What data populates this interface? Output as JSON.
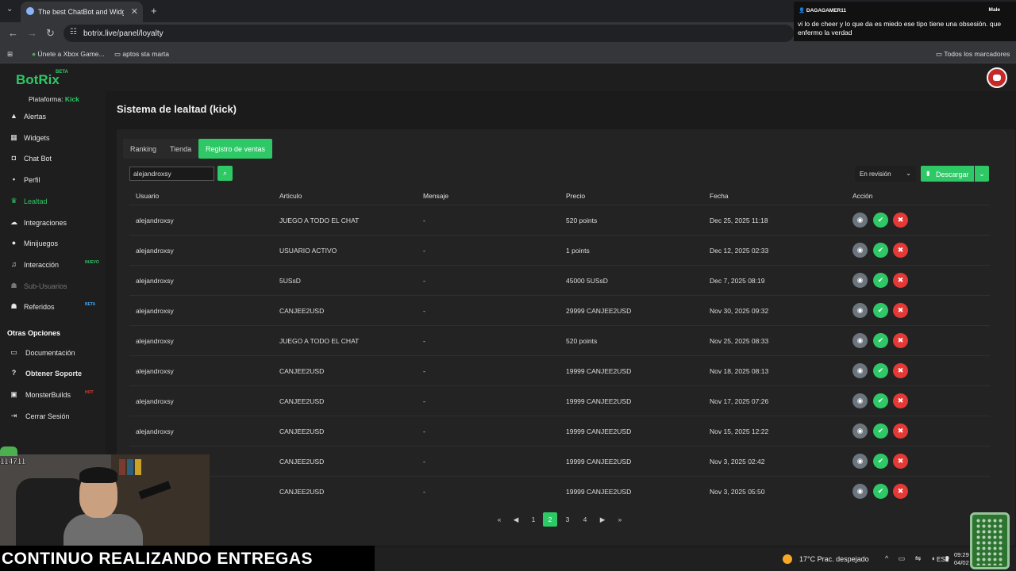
{
  "browser": {
    "tab_title": "The best ChatBot and Widgets",
    "url": "botrix.live/panel/loyalty",
    "bookmarks": [
      "Únete a Xbox Game...",
      "aptos sta marta"
    ],
    "all_bookmarks": "Todos los marcadores"
  },
  "chat_overlay": {
    "user": "DAGAGAMER11",
    "tag": "Male",
    "message": "vi lo de cheer y lo que da es miedo ese tipo tiene una obsesión. que enfermo la verdad"
  },
  "app": {
    "logo": "BotRix",
    "beta": "BETA",
    "platform_label": "Plataforma:",
    "platform_value": "Kick"
  },
  "sidebar": {
    "items": [
      {
        "label": "Alertas",
        "icon": "warning-icon"
      },
      {
        "label": "Widgets",
        "icon": "grid-icon"
      },
      {
        "label": "Chat Bot",
        "icon": "robot-icon"
      },
      {
        "label": "Perfil",
        "icon": "user-icon"
      },
      {
        "label": "Lealtad",
        "icon": "trophy-icon"
      },
      {
        "label": "Integraciones",
        "icon": "cloud-icon"
      },
      {
        "label": "Minijuegos",
        "icon": "gamepad-icon"
      },
      {
        "label": "Interacción",
        "icon": "music-icon",
        "badge": "NUEVO"
      },
      {
        "label": "Sub-Usuarios",
        "icon": "users-icon"
      },
      {
        "label": "Referidos",
        "icon": "users-icon",
        "badge": "BETA"
      }
    ],
    "other_title": "Otras Opciones",
    "other_items": [
      {
        "label": "Documentación",
        "icon": "book-icon"
      },
      {
        "label": "Obtener Soporte",
        "icon": "help-icon"
      },
      {
        "label": "MonsterBuilds",
        "icon": "monitor-icon",
        "badge": "HOT"
      },
      {
        "label": "Cerrar Sesión",
        "icon": "logout-icon"
      }
    ]
  },
  "main": {
    "title": "Sistema de lealtad (kick)",
    "tabs": [
      "Ranking",
      "Tienda",
      "Registro de ventas"
    ],
    "search_value": "alejandroxsy",
    "filter_value": "En revisión",
    "download_label": "Descargar",
    "columns": [
      "Usuario",
      "Articulo",
      "Mensaje",
      "Precio",
      "Fecha",
      "Acción"
    ],
    "rows": [
      {
        "user": "alejandroxsy",
        "item": "JUEGO A TODO EL CHAT",
        "msg": "-",
        "price": "520 points",
        "date": "Dec 25, 2025 11:18"
      },
      {
        "user": "alejandroxsy",
        "item": "USUARIO ACTIVO",
        "msg": "-",
        "price": "1 points",
        "date": "Dec 12, 2025 02:33"
      },
      {
        "user": "alejandroxsy",
        "item": "5USsD",
        "msg": "-",
        "price": "45000 5USsD",
        "date": "Dec 7, 2025 08:19"
      },
      {
        "user": "alejandroxsy",
        "item": "CANJEE2USD",
        "msg": "-",
        "price": "29999 CANJEE2USD",
        "date": "Nov 30, 2025 09:32"
      },
      {
        "user": "alejandroxsy",
        "item": "JUEGO A TODO EL CHAT",
        "msg": "-",
        "price": "520 points",
        "date": "Nov 25, 2025 08:33"
      },
      {
        "user": "alejandroxsy",
        "item": "CANJEE2USD",
        "msg": "-",
        "price": "19999 CANJEE2USD",
        "date": "Nov 18, 2025 08:13"
      },
      {
        "user": "alejandroxsy",
        "item": "CANJEE2USD",
        "msg": "-",
        "price": "19999 CANJEE2USD",
        "date": "Nov 17, 2025 07:26"
      },
      {
        "user": "alejandroxsy",
        "item": "CANJEE2USD",
        "msg": "-",
        "price": "19999 CANJEE2USD",
        "date": "Nov 15, 2025 12:22"
      },
      {
        "user": "",
        "item": "CANJEE2USD",
        "msg": "-",
        "price": "19999 CANJEE2USD",
        "date": "Nov 3, 2025 02:42"
      },
      {
        "user": "",
        "item": "CANJEE2USD",
        "msg": "-",
        "price": "19999 CANJEE2USD",
        "date": "Nov 3, 2025 05:50"
      }
    ],
    "pagination": {
      "pages": [
        "1",
        "2",
        "3",
        "4"
      ],
      "current": "2"
    }
  },
  "stream": {
    "cam_id": "114711",
    "banner": "CONTINUO REALIZANDO ENTREGAS"
  },
  "taskbar": {
    "weather": "17°C  Prac. despejado",
    "lang": "ESP",
    "time": "09:29",
    "date": "04/02"
  },
  "colors": {
    "accent": "#2ec866",
    "danger": "#e53935",
    "muted": "#6c757d"
  }
}
